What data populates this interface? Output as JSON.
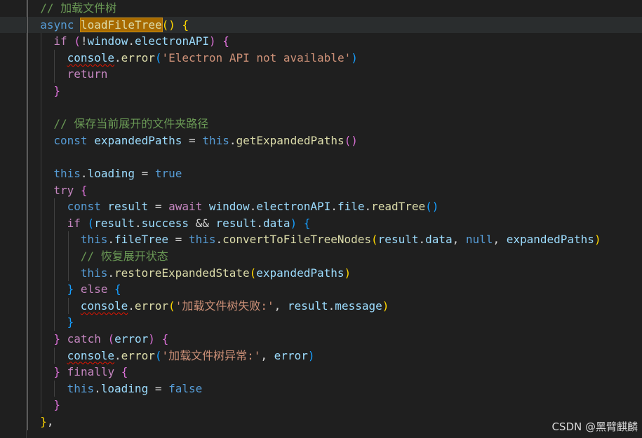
{
  "colors": {
    "background": "#1f1f1f",
    "keyword": "#569cd6",
    "control": "#c586c0",
    "function": "#dcdcaa",
    "variable": "#9cdcfe",
    "string": "#ce9178",
    "comment": "#6a9955",
    "bracket_level1": "#ffd700",
    "bracket_level2": "#da70d6",
    "bracket_level3": "#179fff",
    "error_squiggle": "#e51400",
    "highlight": "#a86b00"
  },
  "lines": [
    {
      "indent": 1,
      "tokens": [
        {
          "c": "cmt",
          "t": "// 加载文件树"
        }
      ]
    },
    {
      "indent": 1,
      "current": true,
      "tokens": [
        {
          "c": "kw",
          "t": "async "
        },
        {
          "c": "hl",
          "t": "loadFileTree"
        },
        {
          "c": "br1",
          "t": "()"
        },
        {
          "c": "pun",
          "t": " "
        },
        {
          "c": "br1",
          "t": "{"
        }
      ]
    },
    {
      "indent": 2,
      "tokens": [
        {
          "c": "ctrl",
          "t": "if "
        },
        {
          "c": "br2",
          "t": "("
        },
        {
          "c": "pun",
          "t": "!"
        },
        {
          "c": "var",
          "t": "window"
        },
        {
          "c": "pun",
          "t": "."
        },
        {
          "c": "var",
          "t": "electronAPI"
        },
        {
          "c": "br2",
          "t": ")"
        },
        {
          "c": "pun",
          "t": " "
        },
        {
          "c": "br2",
          "t": "{"
        }
      ]
    },
    {
      "indent": 3,
      "tokens": [
        {
          "c": "var",
          "t": "console",
          "sq": true
        },
        {
          "c": "pun",
          "t": "."
        },
        {
          "c": "fn",
          "t": "error"
        },
        {
          "c": "br3",
          "t": "("
        },
        {
          "c": "str",
          "t": "'Electron API not available'"
        },
        {
          "c": "br3",
          "t": ")"
        }
      ]
    },
    {
      "indent": 3,
      "tokens": [
        {
          "c": "ctrl",
          "t": "return"
        }
      ]
    },
    {
      "indent": 2,
      "tokens": [
        {
          "c": "br2",
          "t": "}"
        }
      ]
    },
    {
      "indent": 0,
      "tokens": []
    },
    {
      "indent": 2,
      "tokens": [
        {
          "c": "cmt",
          "t": "// 保存当前展开的文件夹路径"
        }
      ]
    },
    {
      "indent": 2,
      "tokens": [
        {
          "c": "kw",
          "t": "const "
        },
        {
          "c": "var",
          "t": "expandedPaths"
        },
        {
          "c": "pun",
          "t": " = "
        },
        {
          "c": "kw",
          "t": "this"
        },
        {
          "c": "pun",
          "t": "."
        },
        {
          "c": "fn",
          "t": "getExpandedPaths"
        },
        {
          "c": "br2",
          "t": "()"
        }
      ]
    },
    {
      "indent": 0,
      "tokens": []
    },
    {
      "indent": 2,
      "tokens": [
        {
          "c": "kw",
          "t": "this"
        },
        {
          "c": "pun",
          "t": "."
        },
        {
          "c": "var",
          "t": "loading"
        },
        {
          "c": "pun",
          "t": " = "
        },
        {
          "c": "kw",
          "t": "true"
        }
      ]
    },
    {
      "indent": 2,
      "tokens": [
        {
          "c": "ctrl",
          "t": "try "
        },
        {
          "c": "br2",
          "t": "{"
        }
      ]
    },
    {
      "indent": 3,
      "tokens": [
        {
          "c": "kw",
          "t": "const "
        },
        {
          "c": "var",
          "t": "result"
        },
        {
          "c": "pun",
          "t": " = "
        },
        {
          "c": "ctrl",
          "t": "await "
        },
        {
          "c": "var",
          "t": "window"
        },
        {
          "c": "pun",
          "t": "."
        },
        {
          "c": "var",
          "t": "electronAPI"
        },
        {
          "c": "pun",
          "t": "."
        },
        {
          "c": "var",
          "t": "file"
        },
        {
          "c": "pun",
          "t": "."
        },
        {
          "c": "fn",
          "t": "readTree"
        },
        {
          "c": "br3",
          "t": "()"
        }
      ]
    },
    {
      "indent": 3,
      "tokens": [
        {
          "c": "ctrl",
          "t": "if "
        },
        {
          "c": "br3",
          "t": "("
        },
        {
          "c": "var",
          "t": "result"
        },
        {
          "c": "pun",
          "t": "."
        },
        {
          "c": "var",
          "t": "success"
        },
        {
          "c": "pun",
          "t": " && "
        },
        {
          "c": "var",
          "t": "result"
        },
        {
          "c": "pun",
          "t": "."
        },
        {
          "c": "var",
          "t": "data"
        },
        {
          "c": "br3",
          "t": ")"
        },
        {
          "c": "pun",
          "t": " "
        },
        {
          "c": "br3",
          "t": "{"
        }
      ]
    },
    {
      "indent": 4,
      "tokens": [
        {
          "c": "kw",
          "t": "this"
        },
        {
          "c": "pun",
          "t": "."
        },
        {
          "c": "var",
          "t": "fileTree"
        },
        {
          "c": "pun",
          "t": " = "
        },
        {
          "c": "kw",
          "t": "this"
        },
        {
          "c": "pun",
          "t": "."
        },
        {
          "c": "fn",
          "t": "convertToFileTreeNodes"
        },
        {
          "c": "br1",
          "t": "("
        },
        {
          "c": "var",
          "t": "result"
        },
        {
          "c": "pun",
          "t": "."
        },
        {
          "c": "var",
          "t": "data"
        },
        {
          "c": "pun",
          "t": ", "
        },
        {
          "c": "kw",
          "t": "null"
        },
        {
          "c": "pun",
          "t": ", "
        },
        {
          "c": "var",
          "t": "expandedPaths"
        },
        {
          "c": "br1",
          "t": ")"
        }
      ]
    },
    {
      "indent": 4,
      "tokens": [
        {
          "c": "cmt",
          "t": "// 恢复展开状态"
        }
      ]
    },
    {
      "indent": 4,
      "tokens": [
        {
          "c": "kw",
          "t": "this"
        },
        {
          "c": "pun",
          "t": "."
        },
        {
          "c": "fn",
          "t": "restoreExpandedState"
        },
        {
          "c": "br1",
          "t": "("
        },
        {
          "c": "var",
          "t": "expandedPaths"
        },
        {
          "c": "br1",
          "t": ")"
        }
      ]
    },
    {
      "indent": 3,
      "tokens": [
        {
          "c": "br3",
          "t": "}"
        },
        {
          "c": "pun",
          "t": " "
        },
        {
          "c": "ctrl",
          "t": "else "
        },
        {
          "c": "br3",
          "t": "{"
        }
      ]
    },
    {
      "indent": 4,
      "tokens": [
        {
          "c": "var",
          "t": "console",
          "sq": true
        },
        {
          "c": "pun",
          "t": "."
        },
        {
          "c": "fn",
          "t": "error"
        },
        {
          "c": "br1",
          "t": "("
        },
        {
          "c": "str",
          "t": "'加载文件树失败:'"
        },
        {
          "c": "pun",
          "t": ", "
        },
        {
          "c": "var",
          "t": "result"
        },
        {
          "c": "pun",
          "t": "."
        },
        {
          "c": "var",
          "t": "message"
        },
        {
          "c": "br1",
          "t": ")"
        }
      ]
    },
    {
      "indent": 3,
      "tokens": [
        {
          "c": "br3",
          "t": "}"
        }
      ]
    },
    {
      "indent": 2,
      "tokens": [
        {
          "c": "br2",
          "t": "}"
        },
        {
          "c": "pun",
          "t": " "
        },
        {
          "c": "ctrl",
          "t": "catch "
        },
        {
          "c": "br2",
          "t": "("
        },
        {
          "c": "var",
          "t": "error"
        },
        {
          "c": "br2",
          "t": ")"
        },
        {
          "c": "pun",
          "t": " "
        },
        {
          "c": "br2",
          "t": "{"
        }
      ]
    },
    {
      "indent": 3,
      "tokens": [
        {
          "c": "var",
          "t": "console",
          "sq": true
        },
        {
          "c": "pun",
          "t": "."
        },
        {
          "c": "fn",
          "t": "error"
        },
        {
          "c": "br3",
          "t": "("
        },
        {
          "c": "str",
          "t": "'加载文件树异常:'"
        },
        {
          "c": "pun",
          "t": ", "
        },
        {
          "c": "var",
          "t": "error"
        },
        {
          "c": "br3",
          "t": ")"
        }
      ]
    },
    {
      "indent": 2,
      "tokens": [
        {
          "c": "br2",
          "t": "}"
        },
        {
          "c": "pun",
          "t": " "
        },
        {
          "c": "ctrl",
          "t": "finally "
        },
        {
          "c": "br2",
          "t": "{"
        }
      ]
    },
    {
      "indent": 3,
      "tokens": [
        {
          "c": "kw",
          "t": "this"
        },
        {
          "c": "pun",
          "t": "."
        },
        {
          "c": "var",
          "t": "loading"
        },
        {
          "c": "pun",
          "t": " = "
        },
        {
          "c": "kw",
          "t": "false"
        }
      ]
    },
    {
      "indent": 2,
      "tokens": [
        {
          "c": "br2",
          "t": "}"
        }
      ]
    },
    {
      "indent": 1,
      "tokens": [
        {
          "c": "br1",
          "t": "}"
        },
        {
          "c": "pun",
          "t": ","
        }
      ]
    }
  ],
  "watermark": "CSDN @黑臂麒麟"
}
